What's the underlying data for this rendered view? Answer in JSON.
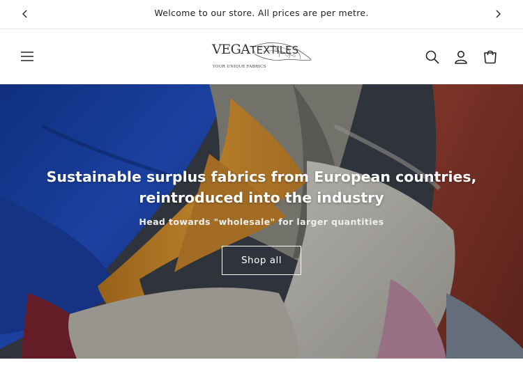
{
  "announcement": {
    "text": "Welcome to our store. All prices are per metre.",
    "prev_icon": "chevron-left-icon",
    "next_icon": "chevron-right-icon"
  },
  "header": {
    "menu_icon": "hamburger-menu-icon",
    "logo": {
      "brand_bold": "VEGA",
      "brand_thin": "TEXTILES",
      "tagline": "YOUR UNIQUE FABRICS"
    },
    "search_icon": "search-icon",
    "account_icon": "account-icon",
    "cart_icon": "cart-icon"
  },
  "hero": {
    "heading": "Sustainable surplus fabrics from European countries, reintroduced into the industry",
    "subheading": "Head towards \"wholesale\" for larger quantities",
    "button_label": "Shop all"
  },
  "colors": {
    "fabric_blue": "#1f45a8",
    "fabric_orange": "#d38e2c",
    "fabric_linen": "#c9c7bd",
    "fabric_rust": "#8f3a2f",
    "fabric_pink": "#b98aa0"
  }
}
